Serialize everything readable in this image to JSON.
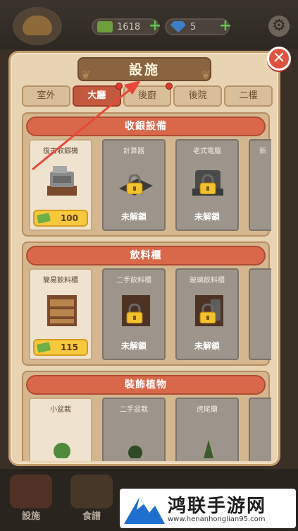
{
  "hud": {
    "cash": "1618",
    "gems": "5",
    "cash_plus": "+",
    "gems_plus": "+",
    "gear": "⚙"
  },
  "panel": {
    "title": "設施",
    "close": "✕"
  },
  "tabs": [
    {
      "label": "室外"
    },
    {
      "label": "大廳"
    },
    {
      "label": "後廚"
    },
    {
      "label": "後院"
    },
    {
      "label": "二樓"
    }
  ],
  "sections": [
    {
      "title": "收銀設備",
      "items": [
        {
          "name": "復古收銀機",
          "price": "100"
        },
        {
          "name": "計算器",
          "status": "未解鎖"
        },
        {
          "name": "老式電腦",
          "status": "未解鎖"
        },
        {
          "name": "新"
        }
      ]
    },
    {
      "title": "飲料櫃",
      "items": [
        {
          "name": "簡易飲料櫃",
          "price": "115"
        },
        {
          "name": "二手飲料櫃",
          "status": "未解鎖"
        },
        {
          "name": "玻璃飲料櫃",
          "status": "未解鎖"
        },
        {
          "name": ""
        }
      ]
    },
    {
      "title": "裝飾植物",
      "items": [
        {
          "name": "小盆栽"
        },
        {
          "name": "二手盆栽"
        },
        {
          "name": "虎尾蘭"
        },
        {
          "name": ""
        }
      ]
    }
  ],
  "bottom_nav": [
    {
      "label": "設施"
    },
    {
      "label": "食譜"
    }
  ],
  "watermark": {
    "title": "鸿联手游网",
    "url": "www.henanhonglian95.com"
  },
  "colors": {
    "accent": "#c5593f",
    "panel": "#e8d3b3",
    "price": "#f8c93c",
    "arrow": "#e8473a"
  }
}
